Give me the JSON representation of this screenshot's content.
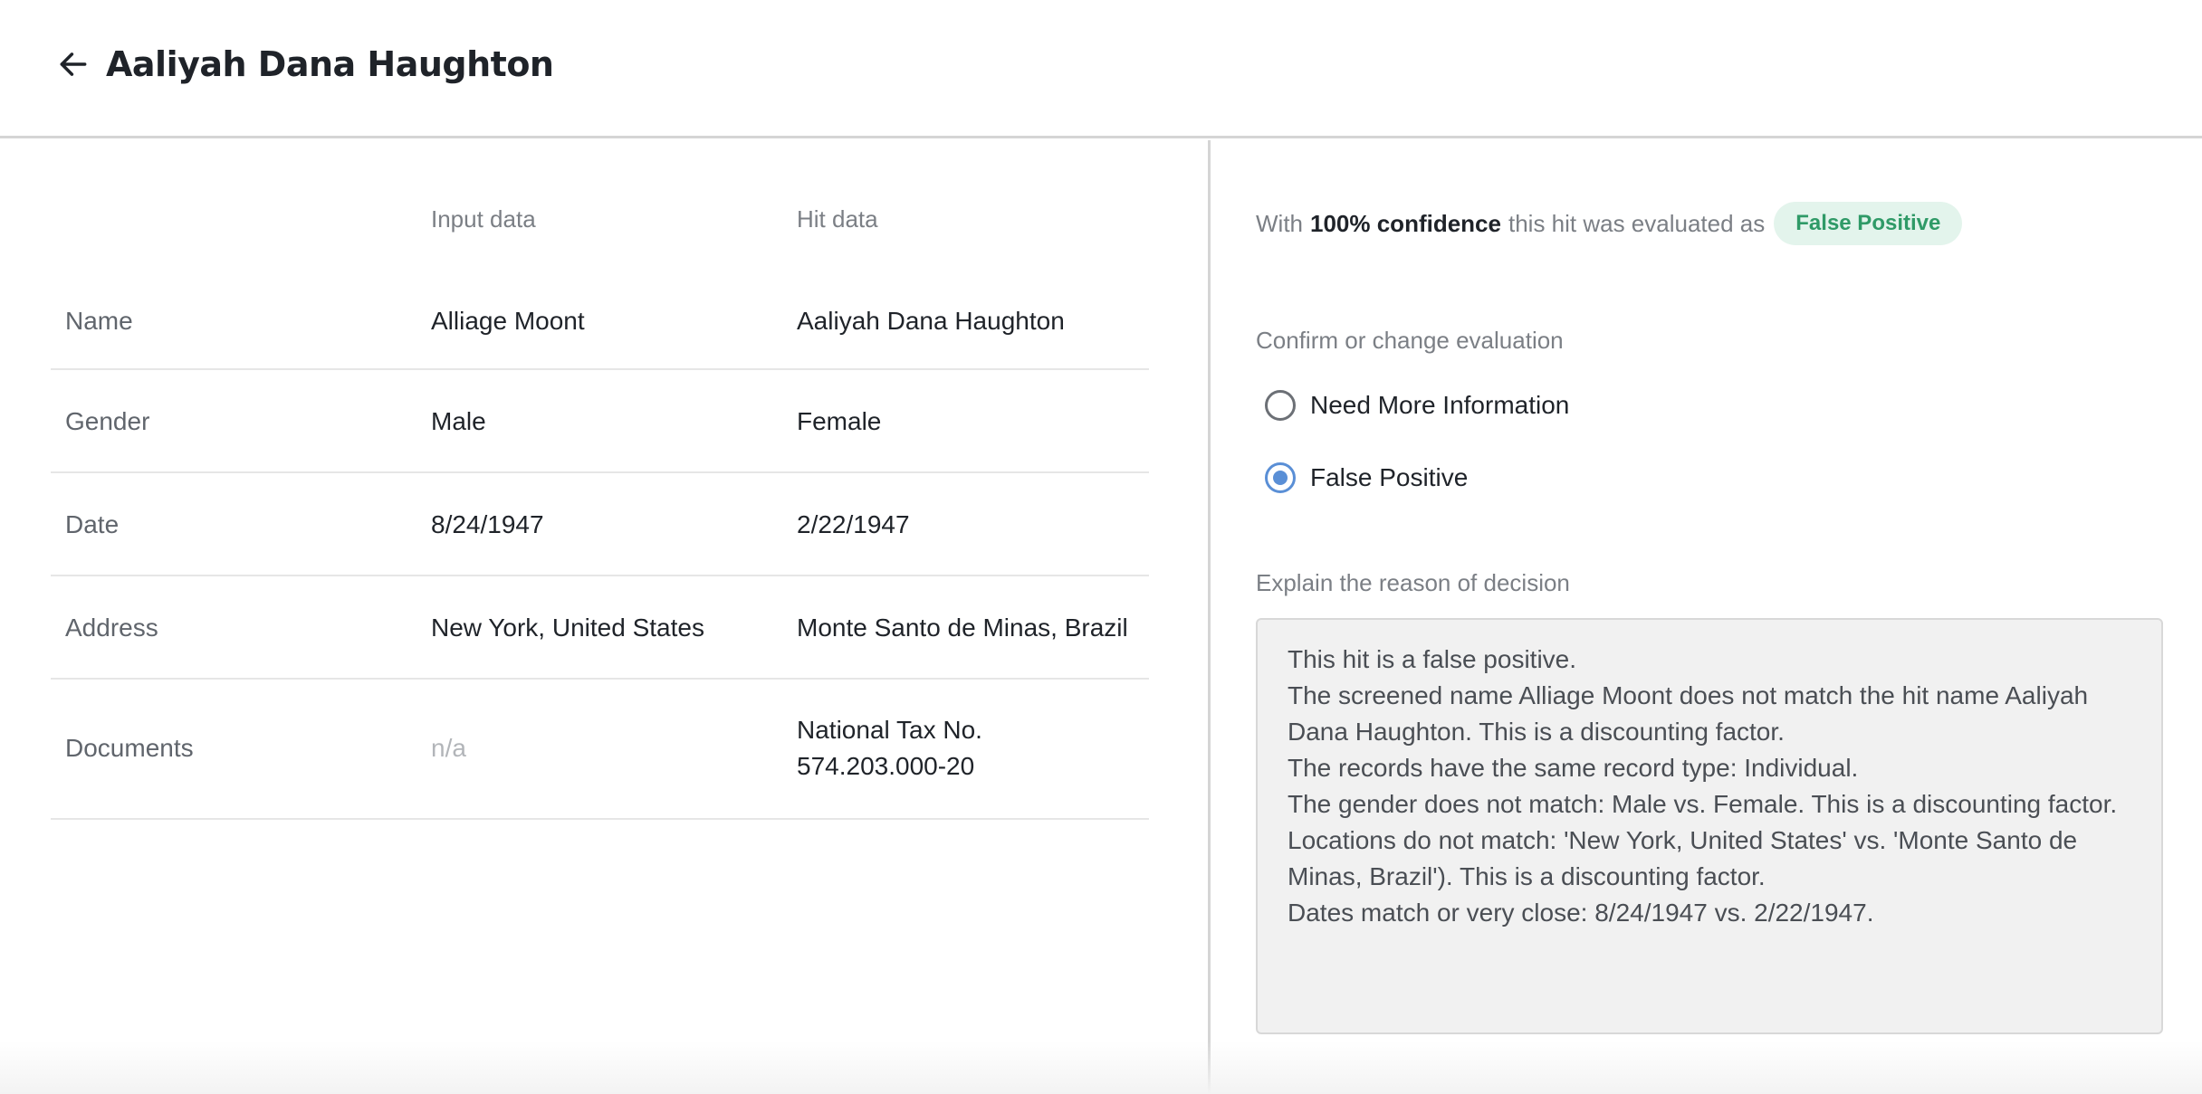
{
  "header": {
    "title": "Aaliyah Dana Haughton",
    "back_icon": "arrow-left-icon"
  },
  "comparison": {
    "columns": {
      "input": "Input data",
      "hit": "Hit data"
    },
    "rows": [
      {
        "label": "Name",
        "input": "Alliage Moont",
        "hit": "Aaliyah Dana Haughton"
      },
      {
        "label": "Gender",
        "input": "Male",
        "hit": "Female"
      },
      {
        "label": "Date",
        "input": "8/24/1947",
        "hit": "2/22/1947"
      },
      {
        "label": "Address",
        "input": "New York, United States",
        "hit": "Monte Santo de Minas, Brazil"
      },
      {
        "label": "Documents",
        "input": "n/a",
        "hit_line1": "National Tax No.",
        "hit_line2": "574.203.000-20"
      }
    ]
  },
  "evaluation": {
    "prefix": "With",
    "confidence": "100% confidence",
    "suffix": "this hit was evaluated as",
    "result_badge": "False Positive",
    "badge_color": "#2f9a67"
  },
  "confirm": {
    "label": "Confirm or change evaluation",
    "options": [
      {
        "label": "Need More Information",
        "checked": false
      },
      {
        "label": "False Positive",
        "checked": true
      }
    ]
  },
  "reason": {
    "label": "Explain the reason of decision",
    "lines": [
      "This hit is a false positive.",
      "The screened name Alliage Moont does not match the hit name Aaliyah",
      "Dana Haughton. This is a discounting factor.",
      "The records have the same record type: Individual.",
      "The gender does not match: Male vs. Female. This is a discounting factor.",
      "Locations do not match: 'New York, United States' vs. 'Monte Santo de",
      "Minas, Brazil'). This is a discounting factor.",
      "Dates match or very close: 8/24/1947 vs. 2/22/1947."
    ]
  },
  "colors": {
    "accent": "#5a8fd6",
    "badge_bg": "#e3f4ec"
  }
}
